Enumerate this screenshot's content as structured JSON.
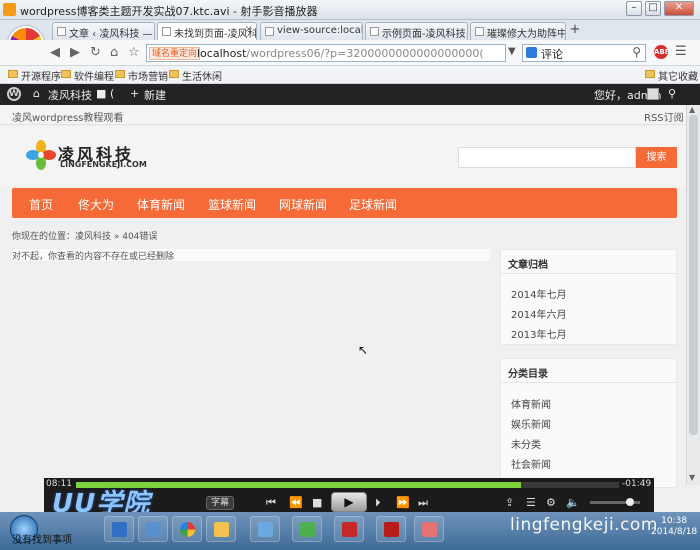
{
  "player": {
    "title": "wordpress博客类主题开发实战07.ktc.avi - 射手影音播放器",
    "elapsed": "08:11",
    "remaining": "-01:49",
    "progress_fraction": 0.82,
    "subtitle_btn": "字幕",
    "brand": "UU学院"
  },
  "browser": {
    "tabs": [
      {
        "label": "文章 ‹ 凌风科技 —"
      },
      {
        "label": "未找到页面-凌风科"
      },
      {
        "label": "view-source:local"
      },
      {
        "label": "示例页面-凌风科技"
      },
      {
        "label": "璀璨修大为助阵中"
      }
    ],
    "address_badge": "域名重定向",
    "url_host": "localhost",
    "url_rest": "/wordpress06/?p=3200000000000000000(",
    "url_hint": "黑",
    "search_value": "评论",
    "abp_label": "ABP",
    "bookmarks": [
      "开源程序",
      "软件编程",
      "市场营销",
      "生活休闲"
    ],
    "bookmarks_right": "其它收藏"
  },
  "adminbar": {
    "site_name": "凌风科技",
    "comments_count": "(",
    "new_label": "新建",
    "greeting": "您好，admin"
  },
  "site": {
    "tagline": "凌风wordpress教程观看",
    "rss": "RSS订阅",
    "logo_cn": "凌风科技",
    "logo_en": "LINGFENGKEJI.COM",
    "search_button": "搜索",
    "menu": [
      "首页",
      "佟大为",
      "体育新闻",
      "篮球新闻",
      "网球新闻",
      "足球新闻"
    ],
    "breadcrumb": "你现在的位置：凌风科技 » 404错误",
    "notice": "对不起，你查看的内容不存在或已经删除",
    "archives": {
      "title": "文章归档",
      "items": [
        "2014年七月",
        "2014年六月",
        "2013年七月"
      ]
    },
    "categories": {
      "title": "分类目录",
      "items": [
        "体育新闻",
        "娱乐新闻",
        "未分类",
        "社会新闻"
      ]
    }
  },
  "taskbar": {
    "status_text": "没有找到事项",
    "watermark": "lingfengkeji.com",
    "time": "10:38",
    "date": "2014/8/18"
  },
  "colors": {
    "accent": "#f56a36",
    "adminbar": "#232323",
    "progress": "#7bd23a"
  }
}
